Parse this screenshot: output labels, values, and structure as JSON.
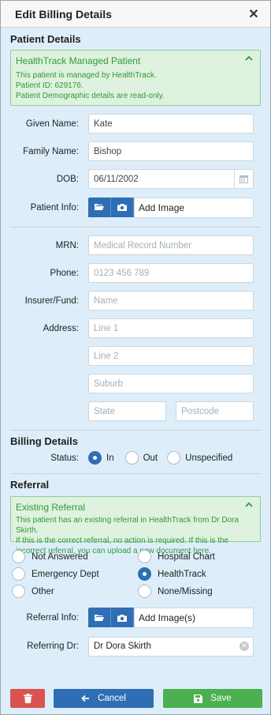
{
  "modal": {
    "title": "Edit Billing Details"
  },
  "patient": {
    "section_title": "Patient Details",
    "alert": {
      "title": "HealthTrack Managed Patient",
      "line1": "This patient is managed by HealthTrack.",
      "line2": "Patient ID: 629176.",
      "line3": "Patient Demographic details are read-only."
    },
    "given_name": {
      "label": "Given Name:",
      "value": "Kate"
    },
    "family_name": {
      "label": "Family Name:",
      "value": "Bishop"
    },
    "dob": {
      "label": "DOB:",
      "value": "06/11/2002"
    },
    "info": {
      "label": "Patient Info:",
      "add_label": "Add Image"
    },
    "mrn": {
      "label": "MRN:",
      "placeholder": "Medical Record Number"
    },
    "phone": {
      "label": "Phone:",
      "placeholder": "0123 456 789"
    },
    "insurer": {
      "label": "Insurer/Fund:",
      "placeholder": "Name"
    },
    "address": {
      "label": "Address:",
      "line1_placeholder": "Line 1",
      "line2_placeholder": "Line 2",
      "suburb_placeholder": "Suburb",
      "state_placeholder": "State",
      "postcode_placeholder": "Postcode"
    }
  },
  "billing": {
    "section_title": "Billing Details",
    "status_label": "Status:",
    "options": [
      "In",
      "Out",
      "Unspecified"
    ],
    "selected": "In"
  },
  "referral": {
    "section_title": "Referral",
    "alert": {
      "title": "Existing Referral",
      "line1": "This patient has an existing referral in HealthTrack from Dr Dora Skirth.",
      "line2": "If this is the correct referral, no action is required. If this is the incorrect referral, you can upload a new document here."
    },
    "options": [
      "Not Answered",
      "Hospital Chart",
      "Emergency Dept",
      "HealthTrack",
      "Other",
      "None/Missing"
    ],
    "selected": "HealthTrack",
    "info": {
      "label": "Referral Info:",
      "add_label": "Add Image(s)"
    },
    "doctor": {
      "label": "Referring Dr:",
      "value": "Dr Dora Skirth"
    }
  },
  "footer": {
    "cancel_label": "Cancel",
    "save_label": "Save"
  },
  "colors": {
    "primary": "#2f6eb5",
    "success": "#4caf50",
    "danger": "#d9534f",
    "alert_text": "#2e9b36"
  }
}
